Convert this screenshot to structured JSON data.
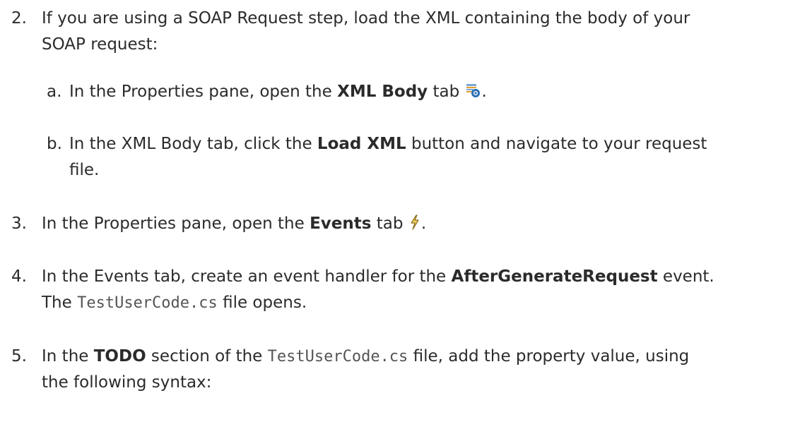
{
  "steps": [
    {
      "num": "2.",
      "text": "If you are using a SOAP Request step, load the XML containing the body of your SOAP request:",
      "substeps": [
        {
          "num": "a.",
          "pre": "In the Properties pane, open the ",
          "bold": "XML Body",
          "post": " tab",
          "icon": "xml-body-tab-icon",
          "end": "."
        },
        {
          "num": "b.",
          "pre": "In the XML Body tab, click the ",
          "bold": "Load XML",
          "post": " button and navigate to your request",
          "cont": "file."
        }
      ]
    },
    {
      "num": "3.",
      "pre": "In the Properties pane, open the ",
      "bold": "Events",
      "post": " tab",
      "icon": "events-tab-icon",
      "end": "."
    },
    {
      "num": "4.",
      "pre": "In the Events tab, create an event handler for the ",
      "bold": "AfterGenerateRequest",
      "post": " event.",
      "line2_pre": "The ",
      "line2_code": "TestUserCode.cs",
      "line2_post": " file opens."
    },
    {
      "num": "5.",
      "pre": "In the ",
      "bold": "TODO",
      "mid": " section of the ",
      "code": "TestUserCode.cs",
      "post": " file, add the property value, using",
      "line2": "the following syntax:"
    }
  ]
}
